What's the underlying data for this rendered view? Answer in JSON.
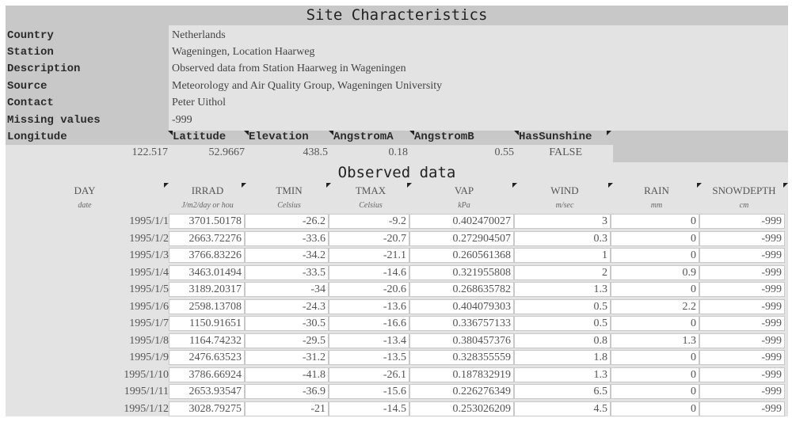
{
  "site": {
    "title": "Site Characteristics",
    "fields": [
      {
        "label": "Country",
        "value": "Netherlands"
      },
      {
        "label": "Station",
        "value": "Wageningen, Location Haarweg"
      },
      {
        "label": "Description",
        "value": "Observed data from Station Haarweg in Wageningen"
      },
      {
        "label": "Source",
        "value": "Meteorology and Air Quality Group, Wageningen University"
      },
      {
        "label": "Contact",
        "value": "Peter Uithol"
      },
      {
        "label": "Missing values",
        "value": "-999"
      }
    ],
    "params": {
      "headers": [
        "Longitude",
        "Latitude",
        "Elevation",
        "AngstromA",
        "AngstromB",
        "HasSunshine"
      ],
      "values": [
        "122.517",
        "52.9667",
        "438.5",
        "0.18",
        "0.55",
        "FALSE"
      ]
    }
  },
  "observed": {
    "title": "Observed data",
    "columns": [
      {
        "name": "DAY",
        "unit": "date"
      },
      {
        "name": "IRRAD",
        "unit": "J/m2/day or hou"
      },
      {
        "name": "TMIN",
        "unit": "Celsius"
      },
      {
        "name": "TMAX",
        "unit": "Celsius"
      },
      {
        "name": "VAP",
        "unit": "kPa"
      },
      {
        "name": "WIND",
        "unit": "m/sec"
      },
      {
        "name": "RAIN",
        "unit": "mm"
      },
      {
        "name": "SNOWDEPTH",
        "unit": "cm"
      }
    ],
    "rows": [
      [
        "1995/1/1",
        "3701.50178",
        "-26.2",
        "-9.2",
        "0.402470027",
        "3",
        "0",
        "-999"
      ],
      [
        "1995/1/2",
        "2663.72276",
        "-33.6",
        "-20.7",
        "0.272904507",
        "0.3",
        "0",
        "-999"
      ],
      [
        "1995/1/3",
        "3766.83226",
        "-34.2",
        "-21.1",
        "0.260561368",
        "1",
        "0",
        "-999"
      ],
      [
        "1995/1/4",
        "3463.01494",
        "-33.5",
        "-14.6",
        "0.321955808",
        "2",
        "0.9",
        "-999"
      ],
      [
        "1995/1/5",
        "3189.20317",
        "-34",
        "-20.6",
        "0.268635782",
        "1.3",
        "0",
        "-999"
      ],
      [
        "1995/1/6",
        "2598.13708",
        "-24.3",
        "-13.6",
        "0.404079303",
        "0.5",
        "2.2",
        "-999"
      ],
      [
        "1995/1/7",
        "1150.91651",
        "-30.5",
        "-16.6",
        "0.336757133",
        "0.5",
        "0",
        "-999"
      ],
      [
        "1995/1/8",
        "1164.74232",
        "-29.5",
        "-13.4",
        "0.380457376",
        "0.8",
        "1.3",
        "-999"
      ],
      [
        "1995/1/9",
        "2476.63523",
        "-31.2",
        "-13.5",
        "0.328355559",
        "1.8",
        "0",
        "-999"
      ],
      [
        "1995/1/10",
        "3786.66924",
        "-41.8",
        "-26.1",
        "0.187832919",
        "1.3",
        "0",
        "-999"
      ],
      [
        "1995/1/11",
        "2653.93547",
        "-36.9",
        "-15.6",
        "0.226276349",
        "6.5",
        "0",
        "-999"
      ],
      [
        "1995/1/12",
        "3028.79275",
        "-21",
        "-14.5",
        "0.253026209",
        "4.5",
        "0",
        "-999"
      ]
    ]
  }
}
